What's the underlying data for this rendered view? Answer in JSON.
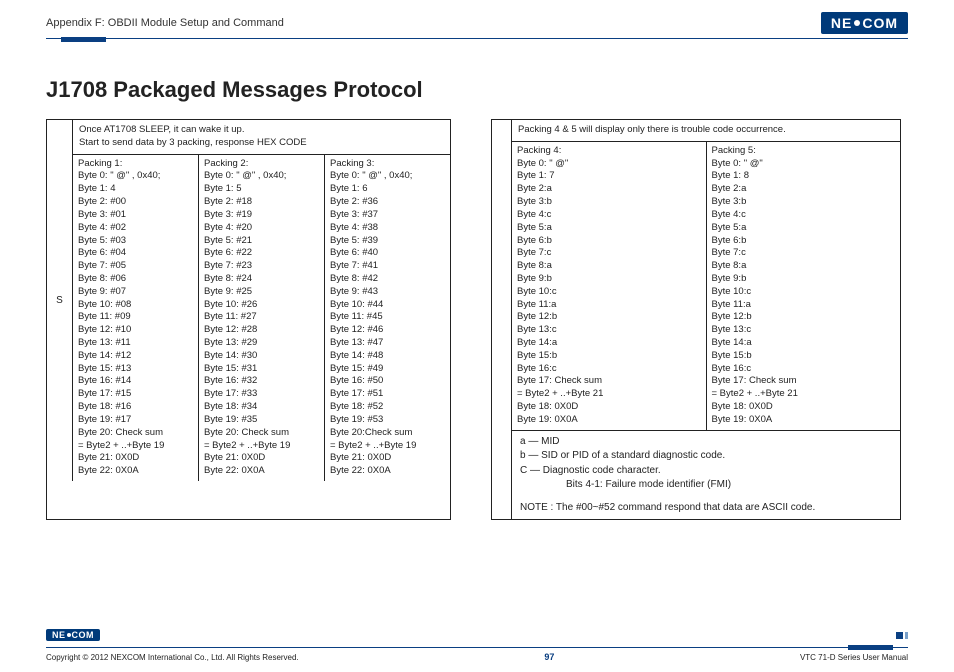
{
  "header": {
    "appendix": "Appendix F: OBDII Module Setup and Command",
    "brand_pre": "NE",
    "brand_post": "COM"
  },
  "title": "J1708 Packaged Messages Protocol",
  "left": {
    "marker": "S",
    "intro1": "Once AT1708 SLEEP, it can wake it up.",
    "intro2": "Start to send data by 3 packing, response HEX CODE",
    "cols": [
      [
        "Packing 1:",
        "Byte 0: \" @\" , 0x40;",
        "Byte 1: 4",
        "Byte 2: #00",
        "Byte 3: #01",
        "Byte 4: #02",
        "Byte 5: #03",
        "Byte 6: #04",
        "Byte 7: #05",
        "Byte 8: #06",
        "Byte 9: #07",
        "Byte 10: #08",
        "Byte 11: #09",
        "Byte 12: #10",
        "Byte 13: #11",
        "Byte 14: #12",
        "Byte 15: #13",
        "Byte 16: #14",
        "Byte 17: #15",
        "Byte 18: #16",
        "Byte 19: #17",
        "Byte 20: Check sum",
        "= Byte2 + ..+Byte 19",
        "Byte 21: 0X0D",
        "Byte 22: 0X0A"
      ],
      [
        "Packing 2:",
        "Byte 0: \" @\" , 0x40;",
        "Byte 1: 5",
        "Byte 2: #18",
        "Byte 3: #19",
        "Byte 4: #20",
        "Byte 5: #21",
        "Byte 6: #22",
        "Byte 7: #23",
        "Byte 8: #24",
        "Byte 9: #25",
        "Byte 10: #26",
        "Byte 11: #27",
        "Byte 12: #28",
        "Byte 13: #29",
        "Byte 14: #30",
        "Byte 15: #31",
        "Byte 16: #32",
        "Byte 17: #33",
        "Byte 18: #34",
        "Byte 19: #35",
        "Byte 20: Check sum",
        "= Byte2 + ..+Byte 19",
        "Byte 21: 0X0D",
        "Byte 22: 0X0A"
      ],
      [
        "Packing 3:",
        "Byte 0: \" @\" , 0x40;",
        "Byte 1: 6",
        "Byte 2: #36",
        "Byte 3: #37",
        "Byte 4: #38",
        "Byte 5: #39",
        "Byte 6: #40",
        "Byte 7: #41",
        "Byte 8: #42",
        "Byte 9: #43",
        "Byte 10: #44",
        "Byte 11: #45",
        "Byte 12: #46",
        "Byte 13: #47",
        "Byte 14: #48",
        "Byte 15: #49",
        "Byte 16: #50",
        "Byte 17: #51",
        "Byte 18: #52",
        "Byte 19: #53",
        "Byte 20:Check sum",
        "= Byte2 + ..+Byte 19",
        "Byte 21: 0X0D",
        "Byte 22: 0X0A"
      ]
    ]
  },
  "right": {
    "intro": "Packing 4 & 5 will display only there is trouble code occurrence.",
    "cols": [
      [
        "Packing 4:",
        "Byte 0: \" @\"",
        "Byte 1: 7",
        "Byte 2:a",
        "Byte 3:b",
        "Byte 4:c",
        "Byte 5:a",
        "Byte 6:b",
        "Byte 7:c",
        "Byte 8:a",
        "Byte 9:b",
        "Byte 10:c",
        "Byte 11:a",
        "Byte 12:b",
        "Byte 13:c",
        "Byte 14:a",
        "Byte 15:b",
        "Byte 16:c",
        "Byte 17: Check sum",
        "= Byte2 + ..+Byte 21",
        "Byte 18: 0X0D",
        "Byte 19: 0X0A"
      ],
      [
        "Packing 5:",
        "Byte 0: \" @\"",
        "Byte 1: 8",
        "Byte 2:a",
        "Byte 3:b",
        "Byte 4:c",
        "Byte 5:a",
        "Byte 6:b",
        "Byte 7:c",
        "Byte 8:a",
        "Byte 9:b",
        "Byte 10:c",
        "Byte 11:a",
        "Byte 12:b",
        "Byte 13:c",
        "Byte 14:a",
        "Byte 15:b",
        "Byte 16:c",
        "Byte 17: Check sum",
        "= Byte2 + ..+Byte 21",
        "Byte 18: 0X0D",
        "Byte 19: 0X0A"
      ]
    ],
    "legend_a": "a — MID",
    "legend_b": "b — SID or PID of a standard diagnostic code.",
    "legend_c": "C — Diagnostic code character.",
    "legend_c2": "Bits 4-1: Failure mode identifier (FMI)",
    "note": "NOTE : The #00~#52 command respond that data are ASCII code."
  },
  "footer": {
    "copyright": "Copyright © 2012 NEXCOM International Co., Ltd. All Rights Reserved.",
    "page": "97",
    "manual": "VTC 71-D Series User Manual"
  }
}
